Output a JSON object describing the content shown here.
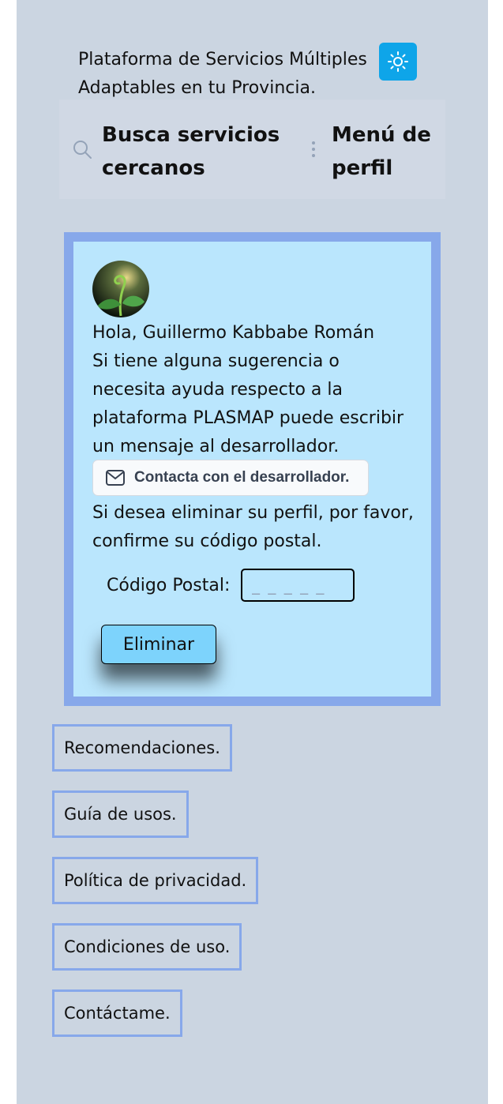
{
  "header": {
    "title": "Plataforma de Servicios Múltiples Adaptables en tu Provincia.",
    "theme_icon": "sun-icon",
    "theme_button_color": "#0ea5e9"
  },
  "search": {
    "icon": "search-icon",
    "label": "Busca servicios cercanos"
  },
  "menu": {
    "icon": "kebab-menu-icon",
    "label": "Menú de perfil"
  },
  "card": {
    "avatar_icon": "avatar-plant-image",
    "greeting": "Hola, Guillermo Kabbabe Román",
    "message": "Si tiene alguna sugerencia o necesita ayuda respecto a la plataforma PLASMAP puede escribir un mensaje al desarrollador.",
    "contact_button_label": "Contacta con el desarrollador.",
    "contact_icon": "mail-icon",
    "delete_info": "Si desea eliminar su perfil, por favor, confirme su código postal.",
    "postal_label": "Código Postal:",
    "postal_value": "",
    "postal_placeholder": "_ _ _ _ _",
    "delete_button_label": "Eliminar"
  },
  "footer_links": [
    "Recomendaciones.",
    "Guía de usos.",
    "Política de privacidad.",
    "Condiciones de uso.",
    "Contáctame."
  ],
  "colors": {
    "page_bg": "#cbd5e1",
    "card_border": "#87a8ea",
    "card_bg": "#bae6fd",
    "delete_button": "#7dd3fc"
  }
}
